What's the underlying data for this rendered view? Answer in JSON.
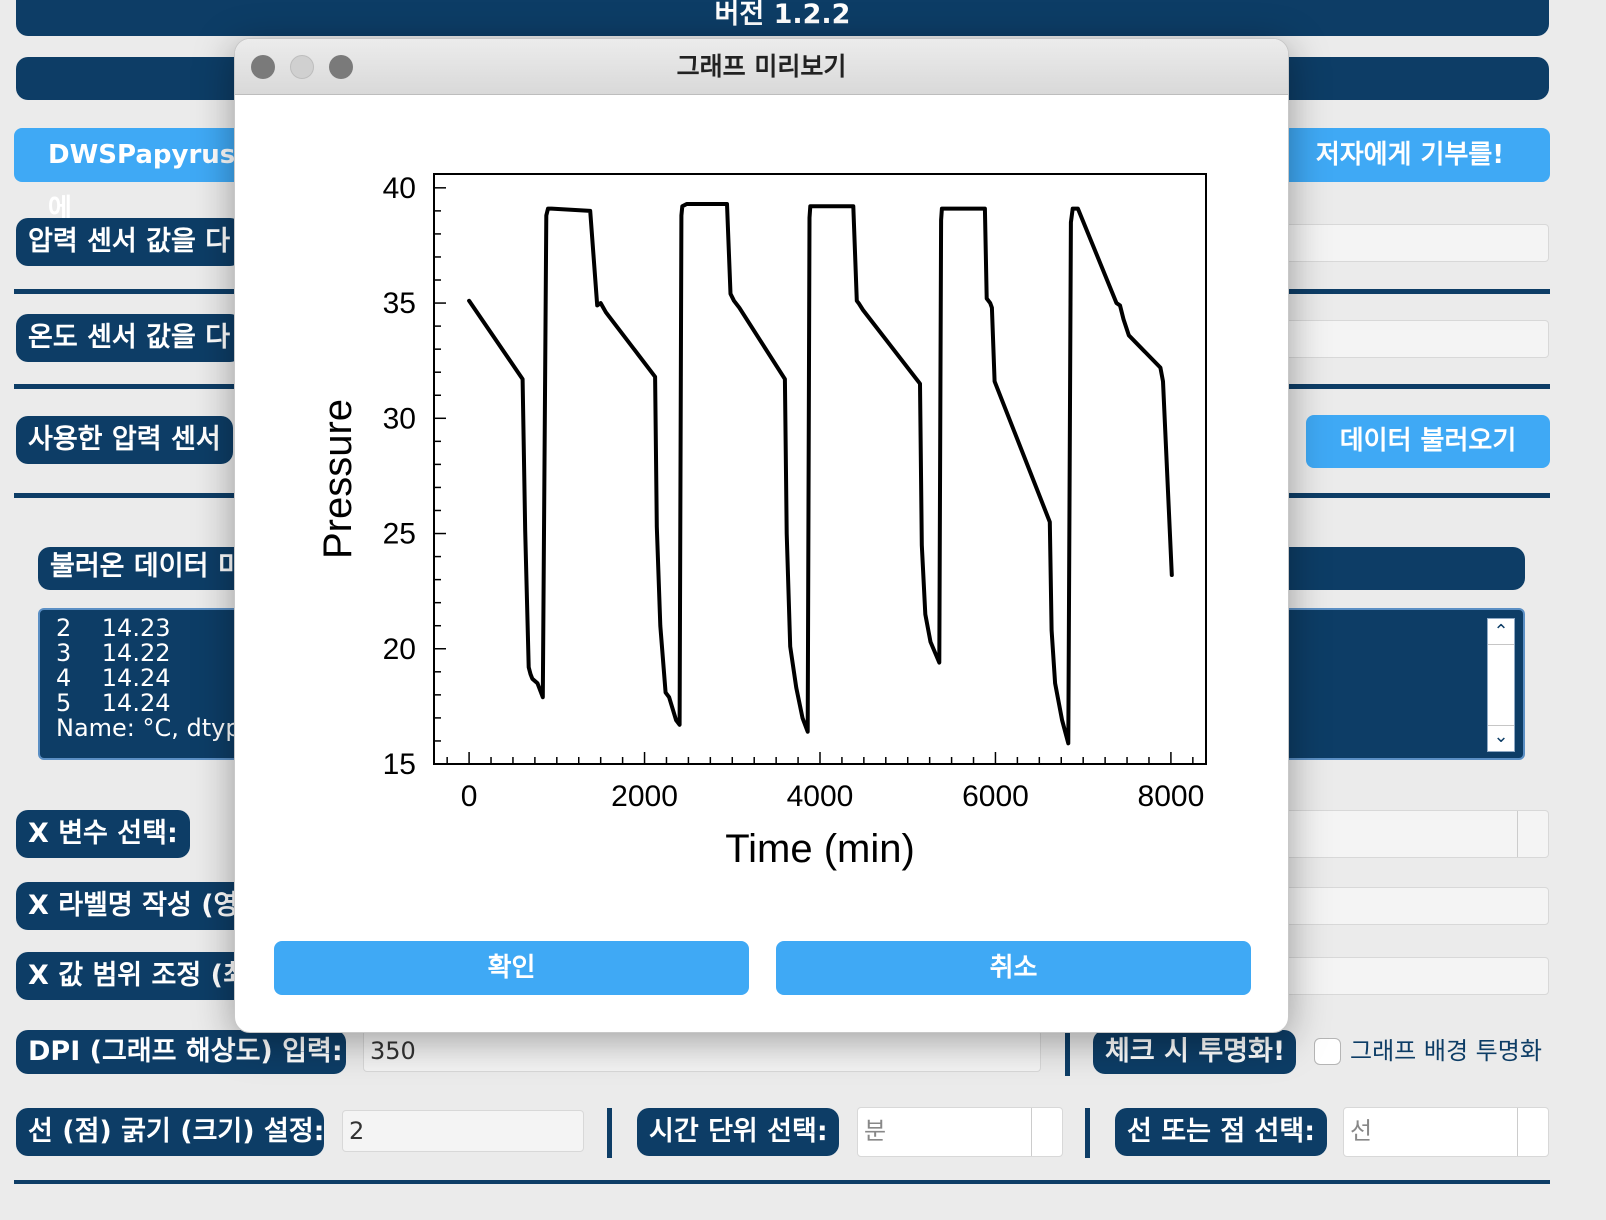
{
  "version": "버전 1.2.2",
  "promo": {
    "left_text": "DWSPapyrus에",
    "right_text": "저자에게 기부를!"
  },
  "rows": {
    "pressure_label": "압력 센서 값을 다",
    "temp_label": "온도 센서 값을 다",
    "sensor_label": "사용한 압력 센서 ",
    "load_button": "데이터 불러오기",
    "loaded_label": "불러온 데이터 미"
  },
  "preview_lines": [
    "2    14.23",
    "3    14.22",
    "4    14.24",
    "5    14.24",
    "Name: °C, dtype"
  ],
  "x_select_label": "X 변수 선택:",
  "x_label_label": "X 라벨명 작성 (영",
  "x_range_label": "X 값 범위 조정 (최",
  "dpi": {
    "label": "DPI (그래프 해상도) 입력:",
    "value": "350"
  },
  "transparent": {
    "label": "체크 시 투명화!",
    "checkbox_label": "그래프 배경 투명화"
  },
  "line_width": {
    "label": "선 (점) 굵기 (크기) 설정:",
    "value": "2"
  },
  "time_unit": {
    "label": "시간 단위 선택:",
    "value": "분"
  },
  "line_or_point": {
    "label": "선 또는 점 선택:",
    "value": "선"
  },
  "dialog": {
    "title": "그래프 미리보기",
    "ok": "확인",
    "cancel": "취소"
  },
  "colors": {
    "navy": "#0d3d66",
    "accent": "#3fa9f5"
  },
  "chart_data": {
    "type": "line",
    "xlabel": "Time (min)",
    "ylabel": "Pressure",
    "xlim": [
      -400,
      8400
    ],
    "ylim": [
      15,
      40.6
    ],
    "xticks": [
      "0",
      "2000",
      "4000",
      "6000",
      "8000"
    ],
    "yticks": [
      "15",
      "20",
      "25",
      "30",
      "35",
      "40"
    ],
    "series": [
      {
        "x": [
          0,
          610,
          640,
          680,
          700,
          720,
          780,
          840,
          880,
          900,
          940,
          1380,
          1460,
          1500,
          1560,
          2120,
          2140,
          2180,
          2240,
          2280,
          2360,
          2400,
          2420,
          2430,
          2480,
          2940,
          2980,
          3020,
          3080,
          3600,
          3620,
          3660,
          3730,
          3800,
          3860,
          3880,
          3890,
          3940,
          4380,
          4420,
          4440,
          4490,
          5140,
          5160,
          5200,
          5260,
          5360,
          5380,
          5390,
          5440,
          5880,
          5900,
          5940,
          5960,
          5990,
          6620,
          6640,
          6680,
          6760,
          6830,
          6860,
          6880,
          6890,
          6940,
          7380,
          7420,
          7460,
          7520,
          7880,
          7910,
          8010
        ],
        "y": [
          35.1,
          31.7,
          25.1,
          19.2,
          18.9,
          18.7,
          18.5,
          17.9,
          38.8,
          39.1,
          39.1,
          39.0,
          34.9,
          35.0,
          34.6,
          31.8,
          25.3,
          21.0,
          18.1,
          17.9,
          16.9,
          16.7,
          38.8,
          39.2,
          39.3,
          39.3,
          35.4,
          35.1,
          34.8,
          31.7,
          25.0,
          20.1,
          18.3,
          17.0,
          16.4,
          38.7,
          39.2,
          39.2,
          39.2,
          35.1,
          35.0,
          34.7,
          31.5,
          24.5,
          21.5,
          20.3,
          19.4,
          38.6,
          39.1,
          39.1,
          39.1,
          35.2,
          35.0,
          34.8,
          31.6,
          25.5,
          20.8,
          18.5,
          16.9,
          15.9,
          38.5,
          39.1,
          39.1,
          39.1,
          35.0,
          34.9,
          34.3,
          33.6,
          32.2,
          31.6,
          23.2
        ]
      }
    ]
  }
}
